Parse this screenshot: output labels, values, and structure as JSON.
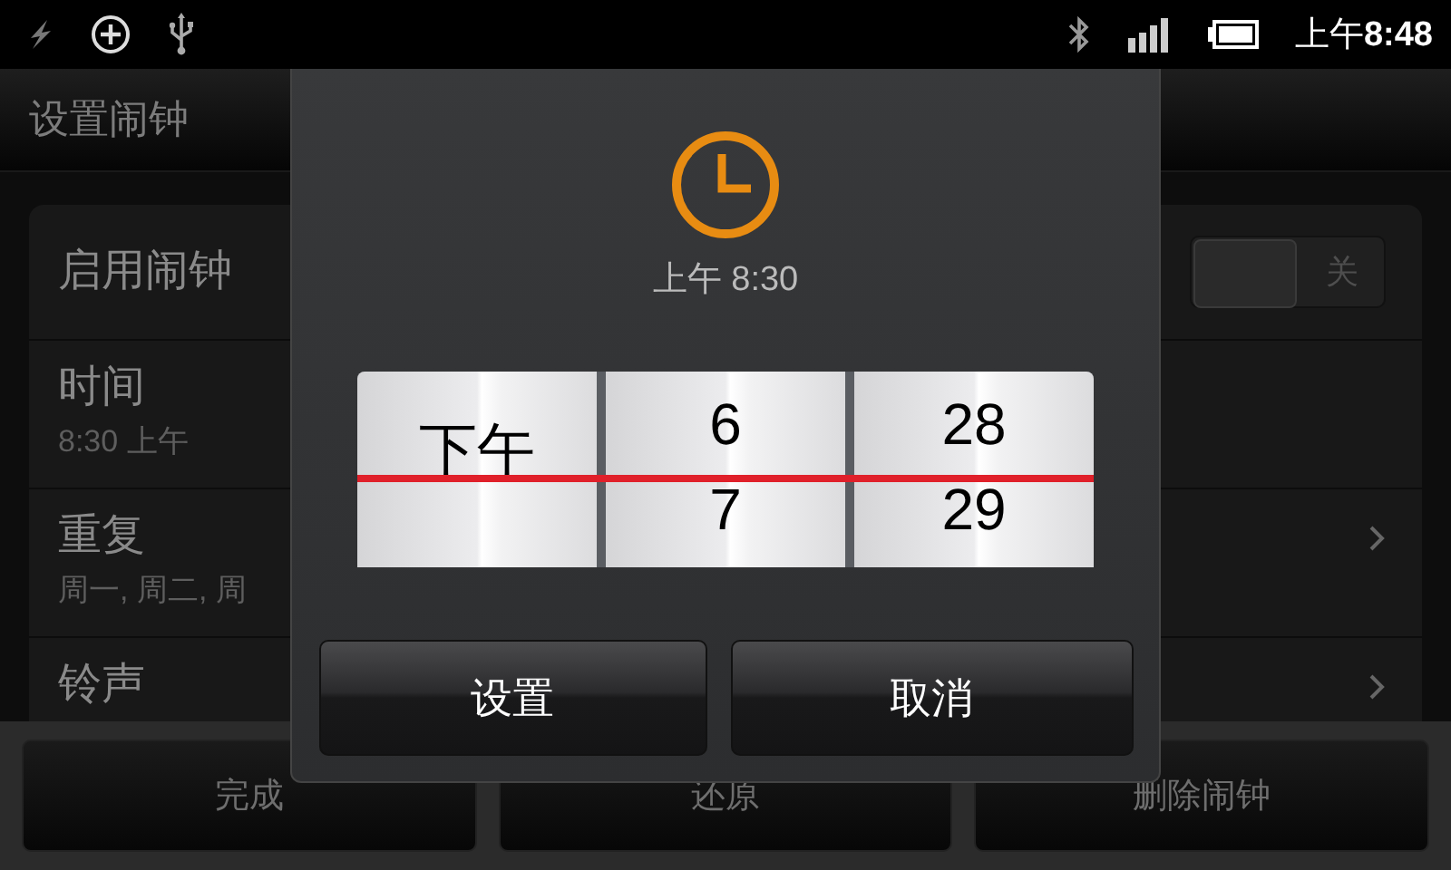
{
  "status_bar": {
    "time": "上午**8:48**"
  },
  "screen": {
    "title": "设置闹钟",
    "settings": [
      {
        "kind": "toggle",
        "label": "启用闹钟",
        "toggle_label": "关",
        "on": false
      },
      {
        "kind": "detail",
        "label": "时间",
        "value": "8:30 上午"
      },
      {
        "kind": "link",
        "label": "重复",
        "value": "周一, 周二, 周"
      },
      {
        "kind": "link",
        "label": "铃声"
      }
    ],
    "actions": [
      "完成",
      "还原",
      "删除闹钟"
    ]
  },
  "dialog": {
    "subtitle": "上午 8:30",
    "picker": [
      {
        "items": [
          "下午"
        ]
      },
      {
        "items": [
          "6",
          "7"
        ]
      },
      {
        "items": [
          "28",
          "29"
        ]
      }
    ],
    "buttons": [
      "设置",
      "取消"
    ]
  }
}
